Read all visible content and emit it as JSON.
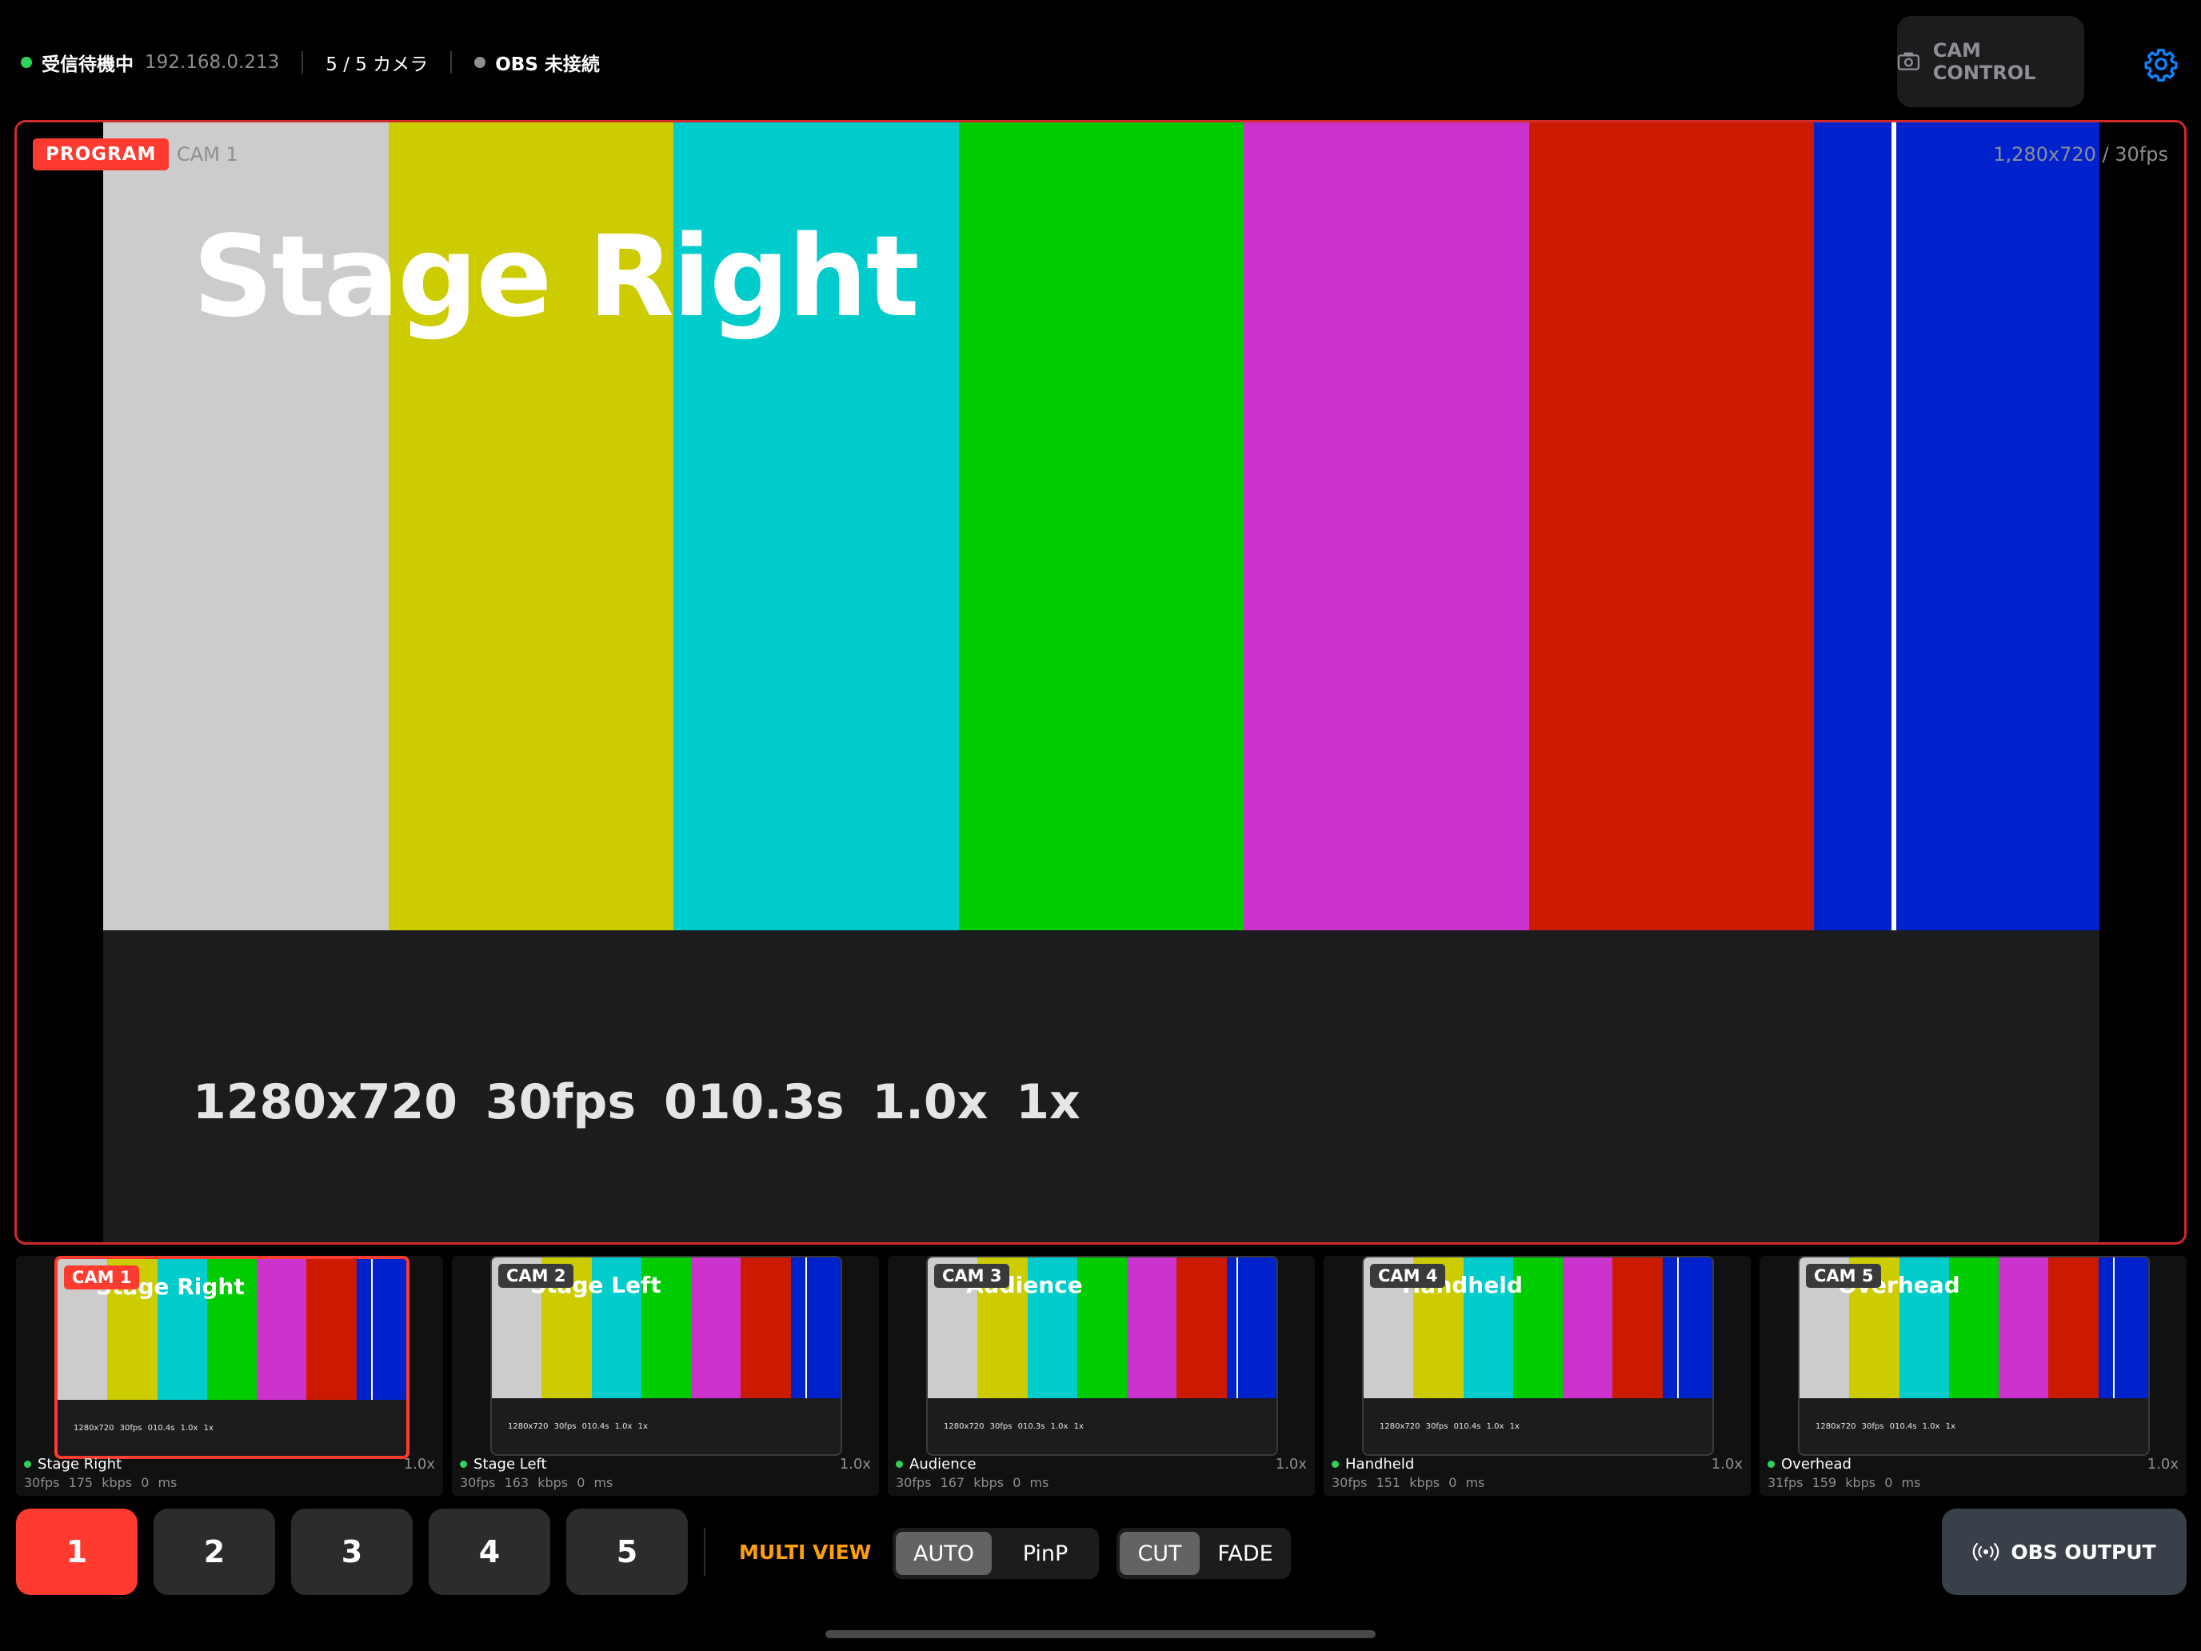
{
  "status_bar": {
    "receive_status": "受信待機中",
    "ip_address": "192.168.0.213",
    "camera_count": "5 / 5 カメラ",
    "obs_status": "OBS 未接続",
    "receive_color": "#30d158",
    "obs_color": "#8e8e93"
  },
  "header": {
    "cam_control_label": "CAM CONTROL",
    "settings_icon": "gear-icon"
  },
  "colors": {
    "accent": "#ff3b30",
    "multiview": "#ff9f0a",
    "bars": [
      "#cccccc",
      "#cccc00",
      "#00cccc",
      "#00cc00",
      "#cc33cc",
      "#cc1a00",
      "#0022cc"
    ]
  },
  "program": {
    "badge": "PROGRAM",
    "camera": "CAM 1",
    "resolution": "1,280x720 / 30fps",
    "title": "Stage Right",
    "info": "1280x720  30fps  010.3s  1.0x  1x"
  },
  "cameras": [
    {
      "badge": "CAM 1",
      "title": "Stage Right",
      "info": "1280x720 30fps 010.4s 1.0x 1x",
      "name": "Stage Right",
      "zoom": "1.0x",
      "stats": "30fps  175 kbps  0 ms",
      "active": true
    },
    {
      "badge": "CAM 2",
      "title": "Stage Left",
      "info": "1280x720 30fps 010.4s 1.0x 1x",
      "name": "Stage Left",
      "zoom": "1.0x",
      "stats": "30fps  163 kbps  0 ms",
      "active": false
    },
    {
      "badge": "CAM 3",
      "title": "Audience",
      "info": "1280x720 30fps 010.3s 1.0x 1x",
      "name": "Audience",
      "zoom": "1.0x",
      "stats": "30fps  167 kbps  0 ms",
      "active": false
    },
    {
      "badge": "CAM 4",
      "title": "Handheld",
      "info": "1280x720 30fps 010.4s 1.0x 1x",
      "name": "Handheld",
      "zoom": "1.0x",
      "stats": "30fps  151 kbps  0 ms",
      "active": false
    },
    {
      "badge": "CAM 5",
      "title": "Overhead",
      "info": "1280x720 30fps 010.4s 1.0x 1x",
      "name": "Overhead",
      "zoom": "1.0x",
      "stats": "31fps  159 kbps  0 ms",
      "active": false
    }
  ],
  "controls": {
    "camera_buttons": [
      "1",
      "2",
      "3",
      "4",
      "5"
    ],
    "selected_camera": "1",
    "multiview_label": "MULTI VIEW",
    "layout_modes": [
      "AUTO",
      "PinP"
    ],
    "layout_selected": "AUTO",
    "transitions": [
      "CUT",
      "FADE"
    ],
    "transition_selected": "CUT",
    "obs_output_label": "OBS OUTPUT"
  }
}
